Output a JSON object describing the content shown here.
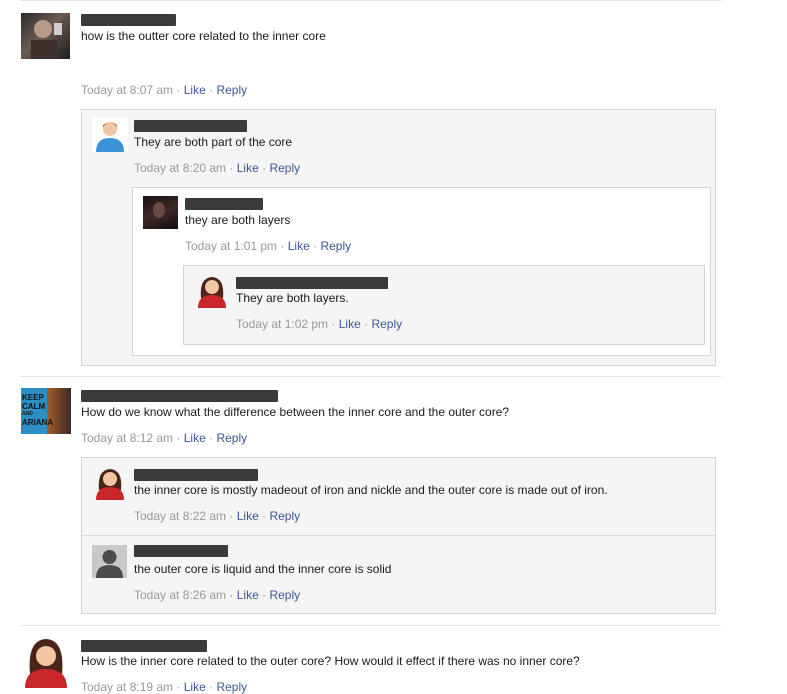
{
  "comments": {
    "c1": {
      "text": "how is the outter core related to the inner core",
      "time": "Today at 8:07 am",
      "like": "Like",
      "reply": "Reply",
      "replies": {
        "r1": {
          "text": "They are both part of the core",
          "time": "Today at 8:20 am",
          "like": "Like",
          "reply": "Reply"
        },
        "r2": {
          "text": "they are both layers",
          "time": "Today at 1:01 pm",
          "like": "Like",
          "reply": "Reply"
        },
        "r3": {
          "text": "They are both layers.",
          "time": "Today at 1:02 pm",
          "like": "Like",
          "reply": "Reply"
        }
      }
    },
    "c2": {
      "text": "How do we know what the difference between the inner core and the outer core?",
      "time": "Today at 8:12 am",
      "like": "Like",
      "reply": "Reply",
      "avatar_text": [
        "KEEP",
        "CALM",
        "AND",
        "ARIANA"
      ],
      "replies": {
        "r1": {
          "text": "the inner core is mostly madeout of iron and nickle and the outer core is made out of iron.",
          "time": "Today at 8:22 am",
          "like": "Like",
          "reply": "Reply"
        },
        "r2": {
          "text": "the outer core is liquid and the inner core is solid",
          "time": "Today at 8:26 am",
          "like": "Like",
          "reply": "Reply"
        }
      }
    },
    "c3": {
      "text": "How is the inner core related to the outer core? How would it effect if there was no inner core?",
      "time": "Today at 8:19 am",
      "like": "Like",
      "reply": "Reply"
    }
  },
  "separator": "·"
}
